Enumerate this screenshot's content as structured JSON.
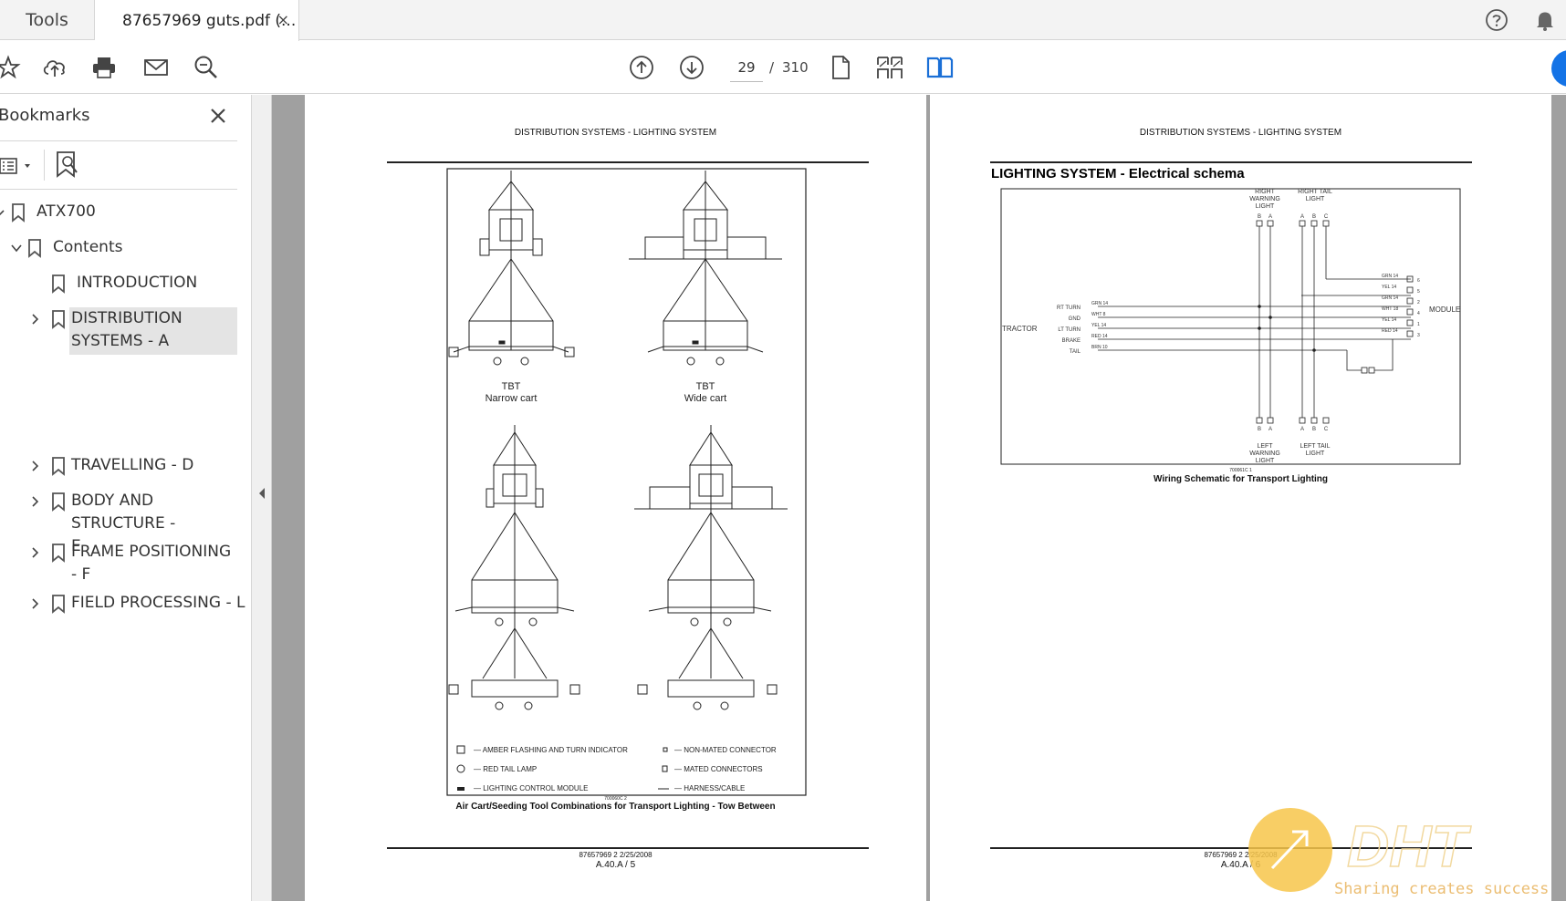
{
  "tabs": {
    "tools_label": "Tools",
    "document_label": "87657969 guts.pdf (...",
    "close_glyph": "×"
  },
  "toolbar": {
    "current_page": "29",
    "page_separator": "/",
    "total_pages": "310",
    "icons": [
      "star-icon",
      "upload-icon",
      "print-icon",
      "mail-icon",
      "zoom-icon",
      "previous-page-icon",
      "next-page-icon",
      "single-page-icon",
      "page-thumbnails-icon",
      "two-page-view-icon"
    ]
  },
  "sidebar": {
    "title": "Bookmarks",
    "items": [
      {
        "label": "ATX700",
        "expanded": true
      },
      {
        "label": "Contents",
        "expanded": true
      },
      {
        "label": "INTRODUCTION"
      },
      {
        "label": "DISTRIBUTION SYSTEMS - A",
        "selected": true
      },
      {
        "label": "TRAVELLING - D"
      },
      {
        "label": "BODY AND STRUCTURE - E"
      },
      {
        "label": "FRAME POSITIONING - F"
      },
      {
        "label": "FIELD PROCESSING - L"
      }
    ]
  },
  "left_page": {
    "header": "DISTRIBUTION SYSTEMS - LIGHTING SYSTEM",
    "diagrams": [
      {
        "label1": "TBT",
        "label2": "Narrow cart"
      },
      {
        "label1": "TBT",
        "label2": "Wide cart"
      }
    ],
    "legend": [
      "— AMBER FLASHING AND TURN INDICATOR",
      "— NON-MATED CONNECTOR",
      "— RED TAIL LAMP",
      "— MATED CONNECTORS",
      "— LIGHTING CONTROL MODULE",
      "— HARNESS/CABLE"
    ],
    "figure_id": "700060C 2",
    "caption": "Air Cart/Seeding Tool Combinations for Transport Lighting - Tow Between",
    "footer_doc": "87657969 2 2/25/2008",
    "footer_page": "A.40.A / 5"
  },
  "right_page": {
    "header": "DISTRIBUTION SYSTEMS - LIGHTING SYSTEM",
    "title": "LIGHTING SYSTEM - Electrical schema",
    "schematic": {
      "right_warning": [
        "RIGHT",
        "WARNING",
        "LIGHT"
      ],
      "right_tail": [
        "RIGHT TAIL",
        "LIGHT"
      ],
      "left_warning": [
        "LEFT",
        "WARNING",
        "LIGHT"
      ],
      "left_tail": [
        "LEFT TAIL",
        "LIGHT"
      ],
      "tractor": "TRACTOR",
      "module": "MODULE",
      "tractor_pins": [
        "RT TURN",
        "GND",
        "LT TURN",
        "BRAKE",
        "TAIL"
      ],
      "tractor_wires": [
        "GRN 14",
        "WHT 8",
        "YEL 14",
        "RED 14",
        "BRN 10"
      ],
      "module_wires": [
        "GRN 14",
        "YEL 14",
        "GRN 14",
        "WHT 18",
        "YEL 14",
        "RED 14"
      ],
      "module_pins": [
        "6",
        "5",
        "2",
        "4",
        "1",
        "3"
      ],
      "top_pins_a": [
        "B",
        "A"
      ],
      "top_pins_b": [
        "A",
        "B",
        "C"
      ],
      "figure_id": "700061C 1"
    },
    "caption": "Wiring Schematic for Transport Lighting",
    "footer_doc": "87657969 2 2/25/2008",
    "footer_page": "A.40.A / 6"
  },
  "watermark": {
    "logo_text": "DHT",
    "slogan": "Sharing creates success"
  }
}
